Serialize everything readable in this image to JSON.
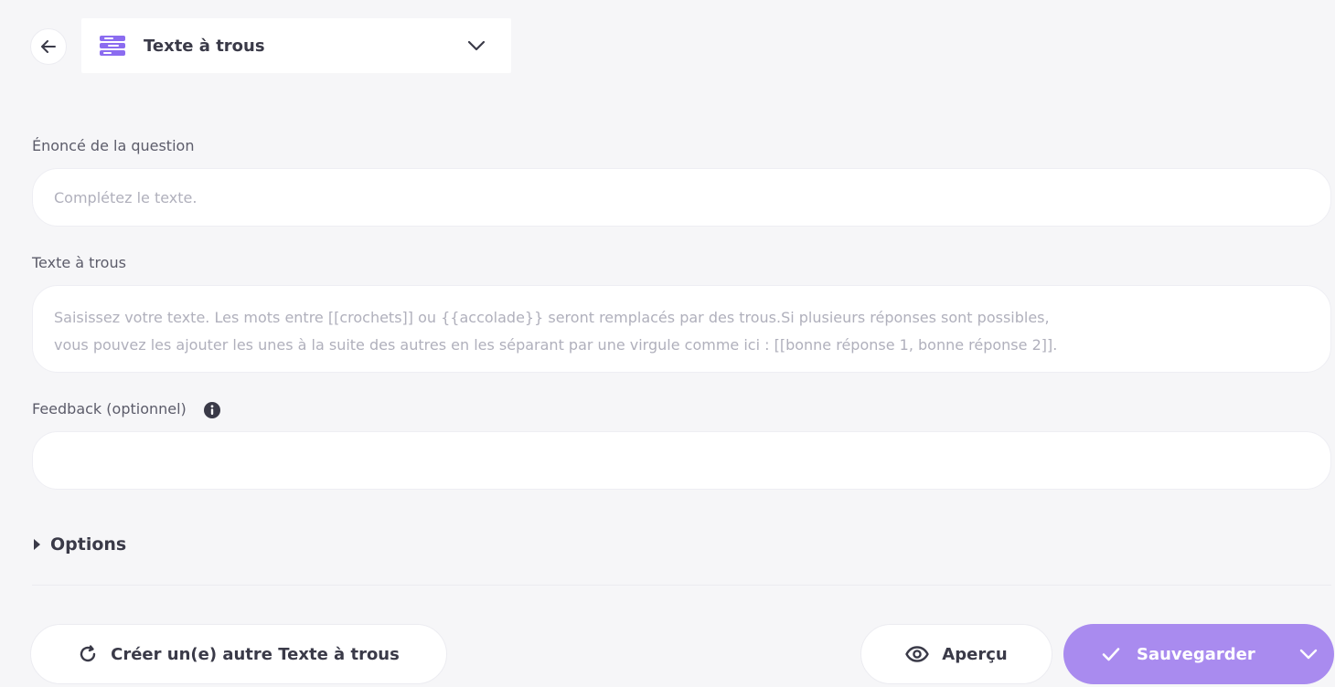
{
  "header": {
    "question_type": "Texte à trous"
  },
  "form": {
    "statement": {
      "label": "Énoncé de la question",
      "placeholder": "Complétez le texte."
    },
    "gap_text": {
      "label": "Texte à trous",
      "placeholder_line1": "Saisissez votre texte. Les mots entre [[crochets]] ou {{accolade}} seront remplacés par des trous.Si plusieurs réponses sont possibles,",
      "placeholder_line2": "vous pouvez les ajouter les unes à la suite des autres en les séparant par une virgule comme ici : [[bonne réponse 1, bonne réponse 2]]."
    },
    "feedback": {
      "label": "Feedback (optionnel)",
      "value": ""
    },
    "options": {
      "label": "Options"
    }
  },
  "footer": {
    "create_another_label": "Créer un(e) autre Texte à trous",
    "preview_label": "Aperçu",
    "save_label": "Sauvegarder"
  },
  "colors": {
    "accent": "#a98bef",
    "icon_purple": "#8b6cf0",
    "background": "#f6f6f8"
  }
}
